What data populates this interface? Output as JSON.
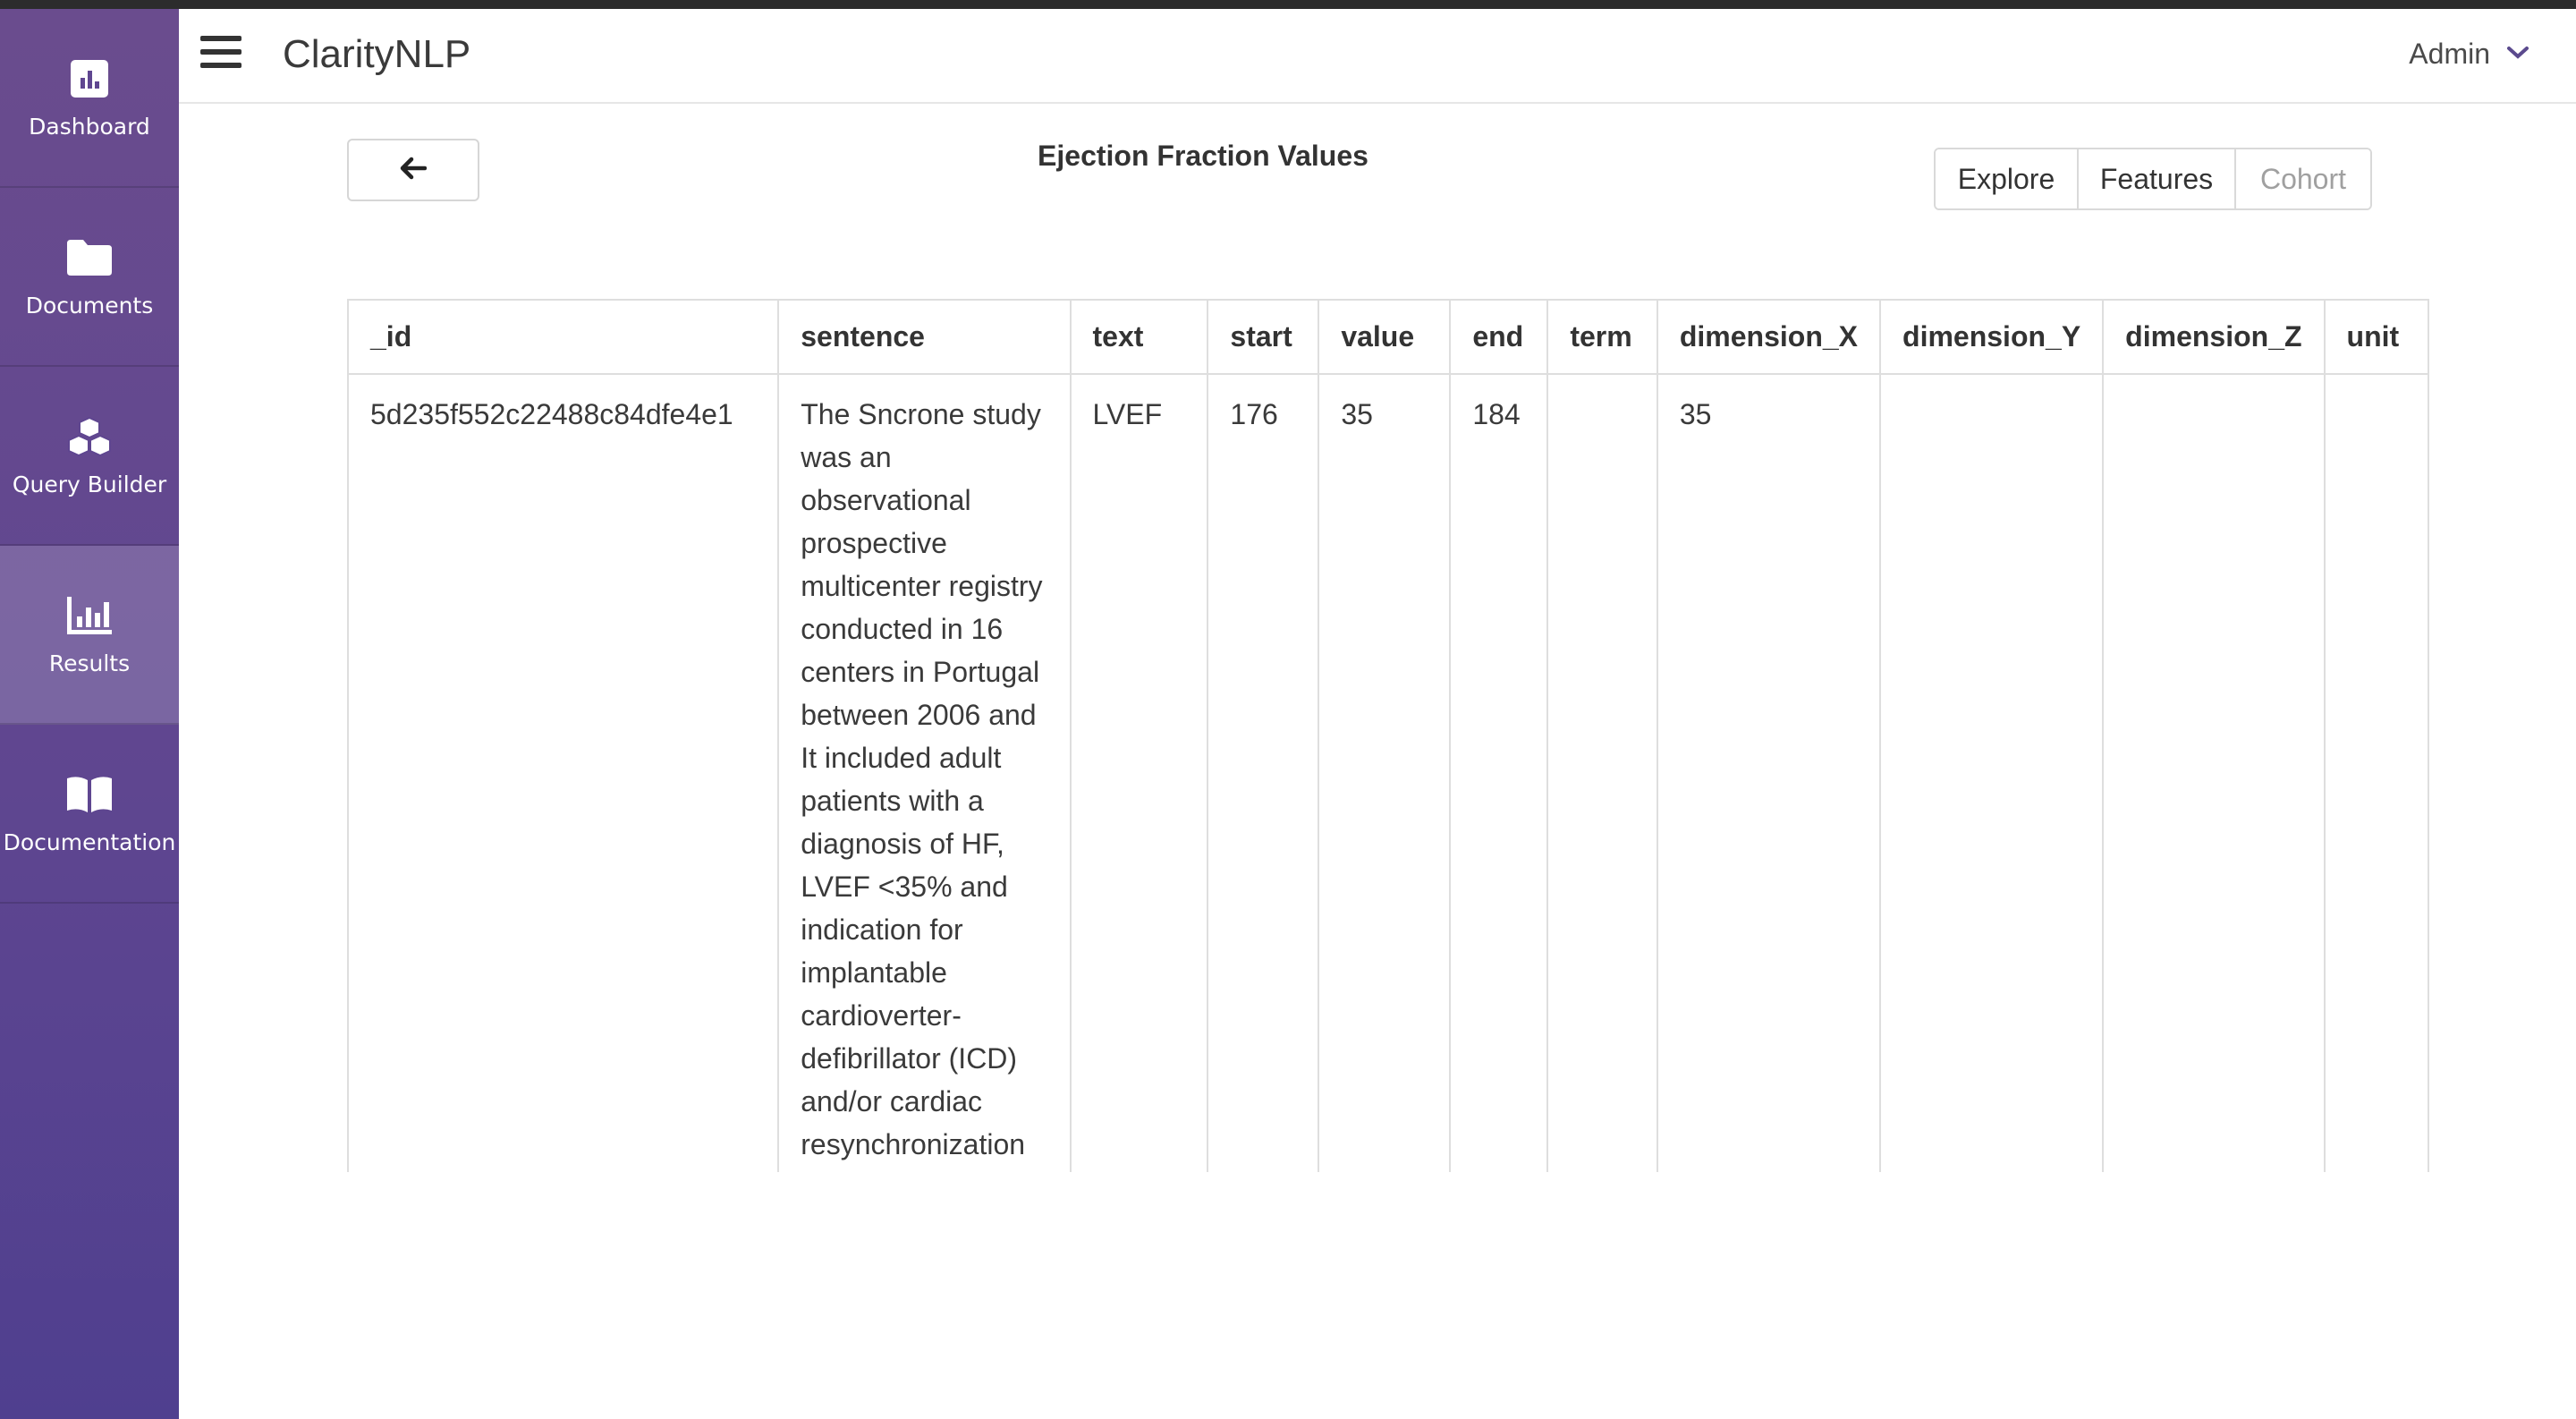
{
  "app": {
    "title": "ClarityNLP",
    "user": "Admin"
  },
  "sidebar": {
    "items": [
      {
        "label": "Dashboard",
        "icon": "dashboard-icon",
        "active": false
      },
      {
        "label": "Documents",
        "icon": "folder-icon",
        "active": false
      },
      {
        "label": "Query Builder",
        "icon": "cubes-icon",
        "active": false
      },
      {
        "label": "Results",
        "icon": "bar-chart-icon",
        "active": true
      },
      {
        "label": "Documentation",
        "icon": "book-icon",
        "active": false
      }
    ]
  },
  "page": {
    "title": "Ejection Fraction Values",
    "back_icon": "arrow-left-icon",
    "view_buttons": [
      {
        "label": "Explore"
      },
      {
        "label": "Features"
      },
      {
        "label": "Cohort",
        "disabled": true
      }
    ]
  },
  "table": {
    "columns": [
      "_id",
      "sentence",
      "text",
      "start",
      "value",
      "end",
      "term",
      "dimension_X",
      "dimension_Y",
      "dimension_Z",
      "unit"
    ],
    "rows": [
      {
        "_id": "5d235f552c22488c84dfe4e1",
        "sentence": "The Sncrone study was an observational prospective multicenter registry conducted in 16 centers in Portugal between 2006 and It included adult patients with a diagnosis of HF, LVEF <35% and indication for implantable cardioverter-defibrillator (ICD) and/or cardiac resynchronization",
        "text": "LVEF",
        "start": "176",
        "value": "35",
        "end": "184",
        "term": "",
        "dimension_X": "35",
        "dimension_Y": "",
        "dimension_Z": "",
        "unit": ""
      }
    ]
  },
  "colors": {
    "sidebar_top": "#6a4c8e",
    "sidebar_bottom": "#4f3f8f",
    "accent": "#5b4a8e"
  }
}
